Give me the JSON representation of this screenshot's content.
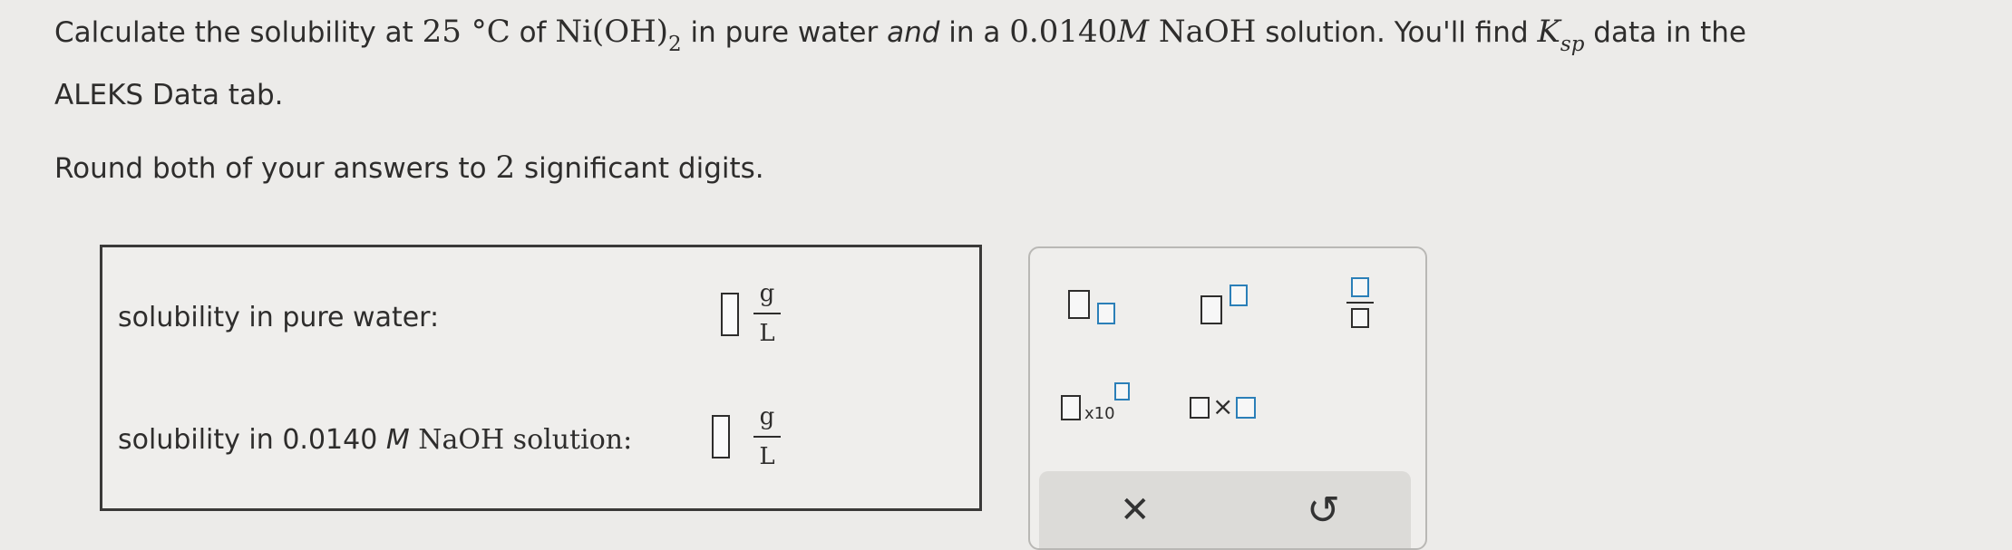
{
  "question": {
    "p1_a": "Calculate the solubility at ",
    "p1_temp": "25 °C",
    "p1_b": " of ",
    "p1_compound": "Ni(OH)",
    "p1_compound_sub": "2",
    "p1_c": " in pure water ",
    "p1_and": "and",
    "p1_d": " in a ",
    "p1_conc": "0.0140",
    "p1_unit": "M",
    "p1_naoh": " NaOH",
    "p1_e": " solution. You'll find ",
    "p1_k": "K",
    "p1_k_sub": "sp",
    "p1_f": "  data in the",
    "p2": "ALEKS Data tab.",
    "p3_a": "Round both of your answers to ",
    "p3_num": "2",
    "p3_b": " significant digits."
  },
  "answers": {
    "row1_label": "solubility in pure water:",
    "row2_label_a": "solubility in 0.0140 ",
    "row2_label_m": "M",
    "row2_label_b": " NaOH solution:",
    "unit_num": "g",
    "unit_den": "L"
  },
  "tools": {
    "x10_label": "x10",
    "times_glyph": "×",
    "clear_glyph": "✕",
    "undo_glyph": "↺"
  },
  "colors": {
    "accent": "#2b7fb8",
    "background": "#ecebe9"
  }
}
